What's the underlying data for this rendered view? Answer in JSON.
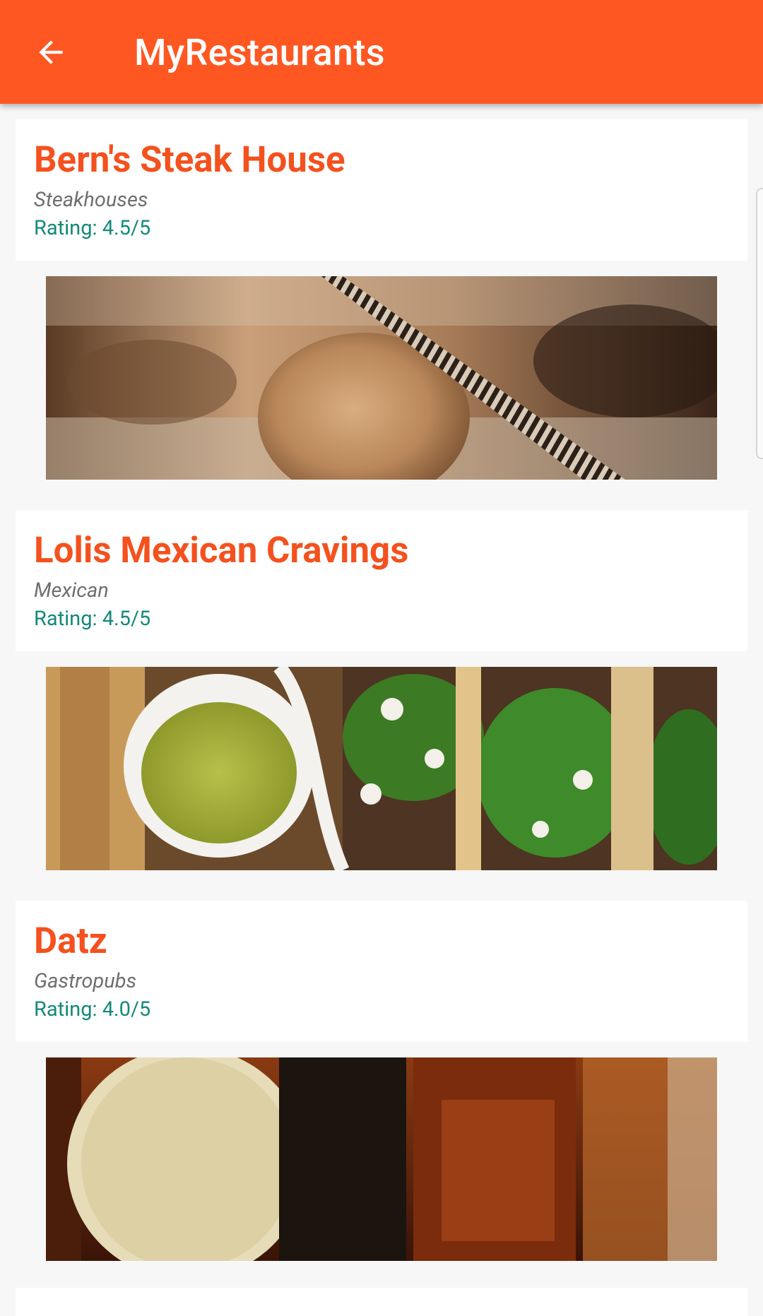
{
  "app_bar": {
    "title": "MyRestaurants",
    "back_icon": "arrow-back-icon",
    "color": "#ff5722"
  },
  "restaurants": [
    {
      "name": "Bern's Steak House",
      "category": "Steakhouses",
      "rating": "Rating: 4.5/5",
      "photo": "ice-cream-dessert-photo"
    },
    {
      "name": "Lolis Mexican Cravings",
      "category": "Mexican",
      "rating": "Rating: 4.5/5",
      "photo": "tacos-and-salsa-photo"
    },
    {
      "name": "Datz",
      "category": "Gastropubs",
      "rating": "Rating: 4.0/5",
      "photo": "whiskey-bottles-photo"
    }
  ],
  "colors": {
    "name": "#f4511e",
    "category": "#6f6f6f",
    "rating": "#13897a",
    "background": "#f7f7f7"
  }
}
